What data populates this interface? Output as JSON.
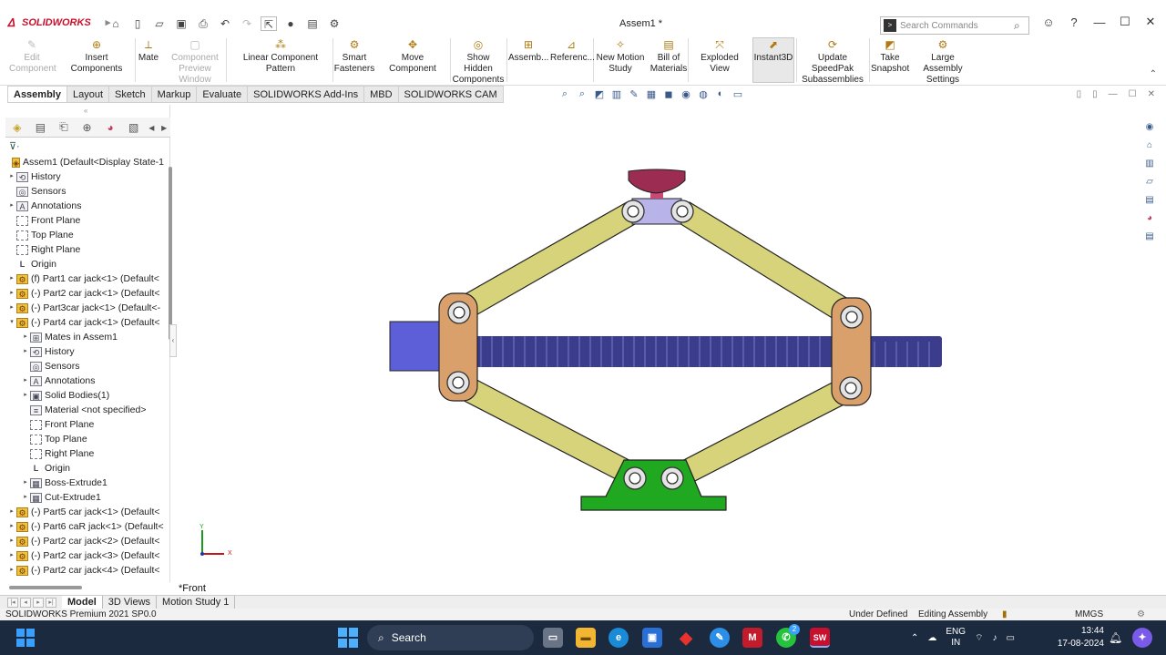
{
  "app": {
    "brand": "SOLIDWORKS",
    "doc_title": "Assem1 *"
  },
  "search": {
    "placeholder": "Search Commands"
  },
  "ribbon": [
    {
      "name": "edit-component",
      "label": "Edit\nComponent",
      "disabled": true
    },
    {
      "name": "insert-components",
      "label": "Insert Components"
    },
    {
      "name": "mate",
      "label": "Mate"
    },
    {
      "name": "component-preview",
      "label": "Component\nPreview Window",
      "disabled": true
    },
    {
      "name": "linear-pattern",
      "label": "Linear Component Pattern"
    },
    {
      "name": "smart-fasteners",
      "label": "Smart\nFasteners"
    },
    {
      "name": "move-component",
      "label": "Move Component"
    },
    {
      "name": "show-hidden",
      "label": "Show Hidden\nComponents"
    },
    {
      "name": "assembly-features",
      "label": "Assemb..."
    },
    {
      "name": "reference-geometry",
      "label": "Referenc..."
    },
    {
      "name": "new-motion-study",
      "label": "New Motion\nStudy"
    },
    {
      "name": "bill-of-materials",
      "label": "Bill of\nMaterials"
    },
    {
      "name": "exploded-view",
      "label": "Exploded View"
    },
    {
      "name": "instant3d",
      "label": "Instant3D",
      "active": true
    },
    {
      "name": "update-speedpak",
      "label": "Update SpeedPak\nSubassemblies"
    },
    {
      "name": "take-snapshot",
      "label": "Take\nSnapshot"
    },
    {
      "name": "large-assembly",
      "label": "Large Assembly\nSettings"
    }
  ],
  "command_tabs": [
    "Assembly",
    "Layout",
    "Sketch",
    "Markup",
    "Evaluate",
    "SOLIDWORKS Add-Ins",
    "MBD",
    "SOLIDWORKS CAM"
  ],
  "tree": [
    {
      "t": "Assem1  (Default<Display State-1",
      "lvl": 0,
      "icon": "asm"
    },
    {
      "t": "History",
      "lvl": 0,
      "arrow": true,
      "icon": "hist"
    },
    {
      "t": "Sensors",
      "lvl": 0,
      "icon": "sens"
    },
    {
      "t": "Annotations",
      "lvl": 0,
      "arrow": true,
      "icon": "ann"
    },
    {
      "t": "Front Plane",
      "lvl": 0,
      "icon": "plane"
    },
    {
      "t": "Top Plane",
      "lvl": 0,
      "icon": "plane"
    },
    {
      "t": "Right Plane",
      "lvl": 0,
      "icon": "plane"
    },
    {
      "t": "Origin",
      "lvl": 0,
      "icon": "origin"
    },
    {
      "t": "(f) Part1 car jack<1> (Default<",
      "lvl": 0,
      "arrow": true,
      "icon": "part"
    },
    {
      "t": "(-) Part2 car jack<1> (Default<",
      "lvl": 0,
      "arrow": true,
      "icon": "part"
    },
    {
      "t": "(-) Part3car jack<1> (Default<-",
      "lvl": 0,
      "arrow": true,
      "icon": "part"
    },
    {
      "t": "(-) Part4 car jack<1> (Default<",
      "lvl": 0,
      "arrow": true,
      "open": true,
      "icon": "part"
    },
    {
      "t": "Mates in Assem1",
      "lvl": 1,
      "arrow": true,
      "icon": "mates"
    },
    {
      "t": "History",
      "lvl": 1,
      "arrow": true,
      "icon": "hist"
    },
    {
      "t": "Sensors",
      "lvl": 1,
      "icon": "sens"
    },
    {
      "t": "Annotations",
      "lvl": 1,
      "arrow": true,
      "icon": "ann"
    },
    {
      "t": "Solid Bodies(1)",
      "lvl": 1,
      "arrow": true,
      "icon": "solid"
    },
    {
      "t": "Material <not specified>",
      "lvl": 1,
      "icon": "mat"
    },
    {
      "t": "Front Plane",
      "lvl": 1,
      "icon": "plane"
    },
    {
      "t": "Top Plane",
      "lvl": 1,
      "icon": "plane"
    },
    {
      "t": "Right Plane",
      "lvl": 1,
      "icon": "plane"
    },
    {
      "t": "Origin",
      "lvl": 1,
      "icon": "origin"
    },
    {
      "t": "Boss-Extrude1",
      "lvl": 1,
      "arrow": true,
      "icon": "feat"
    },
    {
      "t": "Cut-Extrude1",
      "lvl": 1,
      "arrow": true,
      "icon": "feat"
    },
    {
      "t": "(-) Part5 car jack<1> (Default<",
      "lvl": 0,
      "arrow": true,
      "icon": "part"
    },
    {
      "t": "(-) Part6 caR jack<1> (Default<",
      "lvl": 0,
      "arrow": true,
      "icon": "part"
    },
    {
      "t": "(-) Part2 car jack<2> (Default<",
      "lvl": 0,
      "arrow": true,
      "icon": "part"
    },
    {
      "t": "(-) Part2 car jack<3> (Default<",
      "lvl": 0,
      "arrow": true,
      "icon": "part"
    },
    {
      "t": "(-) Part2 car jack<4> (Default<",
      "lvl": 0,
      "arrow": true,
      "icon": "part"
    }
  ],
  "viewport": {
    "view_label": "*Front",
    "axis_y": "Y",
    "axis_x": "X"
  },
  "bottom_tabs": [
    "Model",
    "3D Views",
    "Motion Study 1"
  ],
  "status": {
    "product": "SOLIDWORKS Premium 2021 SP0.0",
    "state": "Under Defined",
    "mode": "Editing Assembly",
    "units": "MMGS"
  },
  "taskbar": {
    "search": "Search",
    "lang1": "ENG",
    "lang2": "IN",
    "time": "13:44",
    "date": "17-08-2024",
    "badge": "2"
  },
  "colors": {
    "link_arm": "#d6d37b",
    "pin_plate": "#d9a06c",
    "screw": "#3b3c8c",
    "base": "#1fa820",
    "knob": "#9c2c52",
    "top_block": "#b8b3e8"
  }
}
